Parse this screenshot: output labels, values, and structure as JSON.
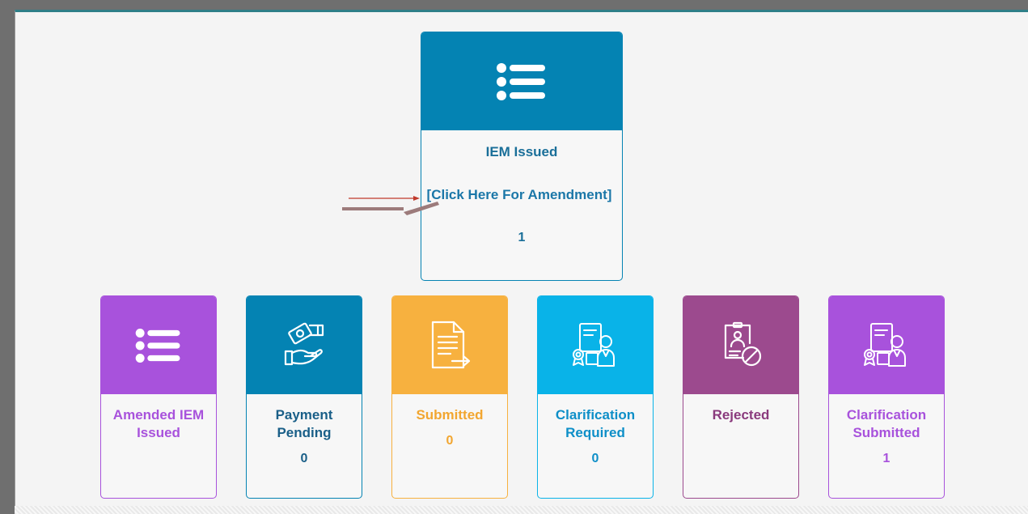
{
  "main_card": {
    "title": "IEM Issued",
    "link": "[Click Here For Amendment]",
    "count": "1",
    "color": "#0483b3",
    "icon": "list-icon"
  },
  "cards": [
    {
      "title": "Amended IEM Issued",
      "count": "",
      "color": "#a852dc",
      "icon": "list-icon"
    },
    {
      "title": "Payment Pending",
      "count": "0",
      "color": "#0483b3",
      "icon": "money-handshake-icon"
    },
    {
      "title": "Submitted",
      "count": "0",
      "color": "#f7b13f",
      "icon": "document-submit-icon"
    },
    {
      "title": "Clarification Required",
      "count": "0",
      "color": "#09b3e8",
      "icon": "certificate-person-icon"
    },
    {
      "title": "Rejected",
      "count": "",
      "color": "#9c4a8e",
      "icon": "profile-rejected-icon"
    },
    {
      "title": "Clarification Submitted",
      "count": "1",
      "color": "#a852dc",
      "icon": "certificate-person-icon"
    }
  ],
  "annotation": {
    "icon": "arrow-pointer-icon",
    "color": "#c0392b"
  }
}
